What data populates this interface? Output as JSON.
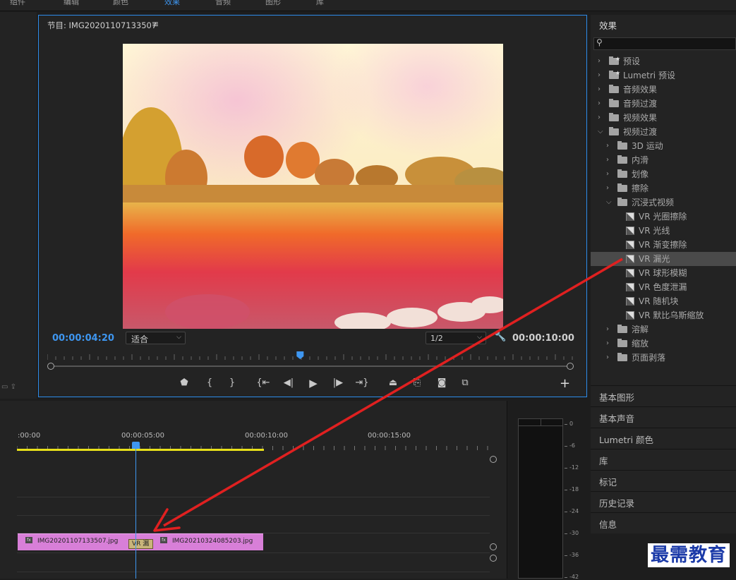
{
  "topbar": {
    "items": [
      "组件",
      "编辑",
      "颜色",
      "效果",
      "音频",
      "图形",
      "库"
    ]
  },
  "monitor": {
    "title": "节目: IMG20201107133507",
    "menu_icon": "hamburger-menu-icon",
    "timecode_current": "00:00:04:20",
    "fit": "适合",
    "resolution": "1/2",
    "timecode_duration": "00:00:10:00",
    "controls": [
      "marker-icon",
      "mark-in-icon",
      "mark-out-icon",
      "go-to-in-icon",
      "step-back-icon",
      "play-icon",
      "step-forward-icon",
      "go-to-out-icon",
      "lift-icon",
      "extract-icon",
      "camera-icon",
      "compare-icon"
    ],
    "playhead_fraction": 0.48
  },
  "effects": {
    "title": "效果",
    "search_placeholder": "",
    "tree": [
      {
        "label": "预设",
        "level": 0,
        "type": "preset",
        "expanded": false
      },
      {
        "label": "Lumetri 预设",
        "level": 0,
        "type": "preset",
        "expanded": false
      },
      {
        "label": "音频效果",
        "level": 0,
        "type": "folder",
        "expanded": false
      },
      {
        "label": "音频过渡",
        "level": 0,
        "type": "folder",
        "expanded": false
      },
      {
        "label": "视频效果",
        "level": 0,
        "type": "folder",
        "expanded": false
      },
      {
        "label": "视频过渡",
        "level": 0,
        "type": "folder",
        "expanded": true
      },
      {
        "label": "3D 运动",
        "level": 1,
        "type": "folder",
        "expanded": false
      },
      {
        "label": "内滑",
        "level": 1,
        "type": "folder",
        "expanded": false
      },
      {
        "label": "划像",
        "level": 1,
        "type": "folder",
        "expanded": false
      },
      {
        "label": "擦除",
        "level": 1,
        "type": "folder",
        "expanded": false
      },
      {
        "label": "沉浸式视频",
        "level": 1,
        "type": "folder",
        "expanded": true
      },
      {
        "label": "VR 光圈擦除",
        "level": 2,
        "type": "effect"
      },
      {
        "label": "VR 光线",
        "level": 2,
        "type": "effect"
      },
      {
        "label": "VR 渐变擦除",
        "level": 2,
        "type": "effect"
      },
      {
        "label": "VR 漏光",
        "level": 2,
        "type": "effect",
        "selected": true
      },
      {
        "label": "VR 球形模糊",
        "level": 2,
        "type": "effect"
      },
      {
        "label": "VR 色度泄漏",
        "level": 2,
        "type": "effect"
      },
      {
        "label": "VR 随机块",
        "level": 2,
        "type": "effect"
      },
      {
        "label": "VR 默比乌斯缩放",
        "level": 2,
        "type": "effect"
      },
      {
        "label": "溶解",
        "level": 1,
        "type": "folder",
        "expanded": false
      },
      {
        "label": "缩放",
        "level": 1,
        "type": "folder",
        "expanded": false
      },
      {
        "label": "页面剥落",
        "level": 1,
        "type": "folder",
        "expanded": false
      }
    ]
  },
  "panels": [
    "基本图形",
    "基本声音",
    "Lumetri 颜色",
    "库",
    "标记",
    "历史记录",
    "信息"
  ],
  "timeline": {
    "ruler_labels": [
      ":00:00",
      "00:00:05:00",
      "00:00:10:00",
      "00:00:15:00"
    ],
    "clips": [
      {
        "name": "IMG20201107133507.jpg"
      },
      {
        "name": "IMG20210324085203.jpg"
      }
    ],
    "transition_label": "VR 漏",
    "fx_badge": "fx"
  },
  "meter": {
    "labels": [
      "0",
      "-6",
      "-12",
      "-18",
      "-24",
      "-30",
      "-36",
      "-42"
    ]
  },
  "watermark": "最需教育",
  "colors": {
    "accent": "#2d8ceb",
    "clip": "#d87fd8",
    "arrow": "#e02020",
    "yellow": "#e8e01a"
  }
}
